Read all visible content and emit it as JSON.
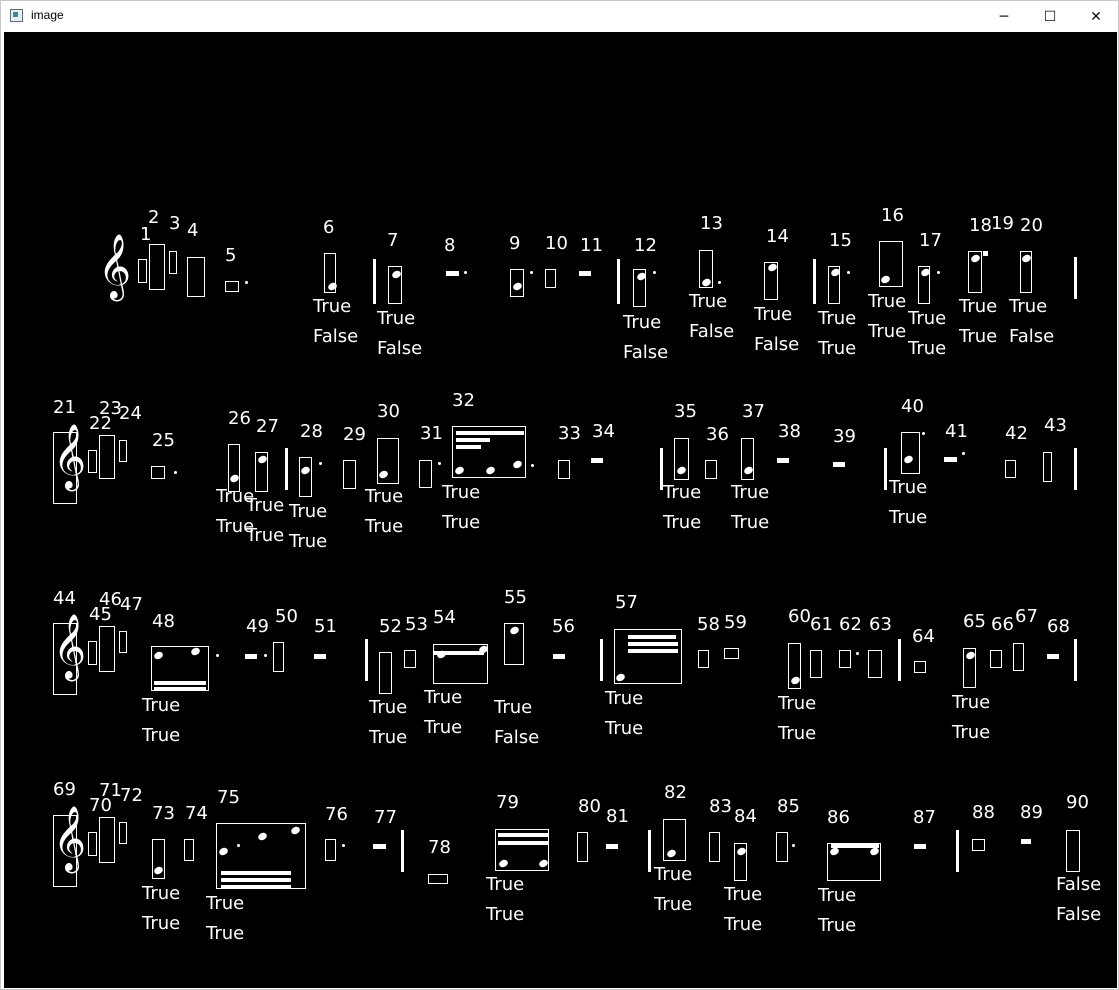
{
  "window": {
    "title": "image",
    "minimize": "─",
    "maximize": "☐",
    "close": "✕"
  },
  "symbols": [
    {
      "n": "1"
    },
    {
      "n": "2"
    },
    {
      "n": "3"
    },
    {
      "n": "4"
    },
    {
      "n": "5"
    },
    {
      "n": "6",
      "a": "True",
      "b": "False"
    },
    {
      "n": "7",
      "a": "True",
      "b": "False"
    },
    {
      "n": "8"
    },
    {
      "n": "9"
    },
    {
      "n": "10"
    },
    {
      "n": "11"
    },
    {
      "n": "12",
      "a": "True",
      "b": "False"
    },
    {
      "n": "13",
      "a": "True",
      "b": "False"
    },
    {
      "n": "14",
      "a": "True",
      "b": "False"
    },
    {
      "n": "15",
      "a": "True",
      "b": "True"
    },
    {
      "n": "16",
      "a": "True",
      "b": "True"
    },
    {
      "n": "17",
      "a": "True",
      "b": "True"
    },
    {
      "n": "18",
      "a": "True",
      "b": "True"
    },
    {
      "n": "19"
    },
    {
      "n": "20",
      "a": "True",
      "b": "False"
    },
    {
      "n": "21"
    },
    {
      "n": "22"
    },
    {
      "n": "23"
    },
    {
      "n": "24"
    },
    {
      "n": "25"
    },
    {
      "n": "26",
      "a": "True",
      "b": "True"
    },
    {
      "n": "27",
      "a": "True",
      "b": "True"
    },
    {
      "n": "28",
      "a": "True",
      "b": "True"
    },
    {
      "n": "29"
    },
    {
      "n": "30",
      "a": "True",
      "b": "True"
    },
    {
      "n": "31"
    },
    {
      "n": "32",
      "a": "True",
      "b": "True"
    },
    {
      "n": "33"
    },
    {
      "n": "34"
    },
    {
      "n": "35",
      "a": "True",
      "b": "True"
    },
    {
      "n": "36"
    },
    {
      "n": "37",
      "a": "True",
      "b": "True"
    },
    {
      "n": "38"
    },
    {
      "n": "39"
    },
    {
      "n": "40",
      "a": "True",
      "b": "True"
    },
    {
      "n": "41"
    },
    {
      "n": "42"
    },
    {
      "n": "43"
    },
    {
      "n": "44"
    },
    {
      "n": "45"
    },
    {
      "n": "46"
    },
    {
      "n": "47"
    },
    {
      "n": "48",
      "a": "True",
      "b": "True"
    },
    {
      "n": "49"
    },
    {
      "n": "50"
    },
    {
      "n": "51"
    },
    {
      "n": "52",
      "a": "True",
      "b": "True"
    },
    {
      "n": "53"
    },
    {
      "n": "54",
      "a": "True",
      "b": "True"
    },
    {
      "n": "55",
      "a": "True",
      "b": "False"
    },
    {
      "n": "56"
    },
    {
      "n": "57",
      "a": "True",
      "b": "True"
    },
    {
      "n": "58"
    },
    {
      "n": "59"
    },
    {
      "n": "60",
      "a": "True",
      "b": "True"
    },
    {
      "n": "61"
    },
    {
      "n": "62"
    },
    {
      "n": "63"
    },
    {
      "n": "64"
    },
    {
      "n": "65",
      "a": "True",
      "b": "True"
    },
    {
      "n": "66"
    },
    {
      "n": "67"
    },
    {
      "n": "68"
    },
    {
      "n": "69"
    },
    {
      "n": "70"
    },
    {
      "n": "71"
    },
    {
      "n": "72"
    },
    {
      "n": "73",
      "a": "True",
      "b": "True"
    },
    {
      "n": "74"
    },
    {
      "n": "75",
      "a": "True",
      "b": "True"
    },
    {
      "n": "76"
    },
    {
      "n": "77"
    },
    {
      "n": "78"
    },
    {
      "n": "79",
      "a": "True",
      "b": "True"
    },
    {
      "n": "80"
    },
    {
      "n": "81"
    },
    {
      "n": "82",
      "a": "True",
      "b": "True"
    },
    {
      "n": "83"
    },
    {
      "n": "84",
      "a": "True",
      "b": "True"
    },
    {
      "n": "85"
    },
    {
      "n": "86",
      "a": "True",
      "b": "True"
    },
    {
      "n": "87"
    },
    {
      "n": "88"
    },
    {
      "n": "89"
    },
    {
      "n": "90",
      "a": "False",
      "b": "False"
    }
  ],
  "clef_glyph": "𝄞",
  "colors": {
    "canvas": "#000000",
    "ink": "#ffffff",
    "titlebar": "#ffffff"
  }
}
